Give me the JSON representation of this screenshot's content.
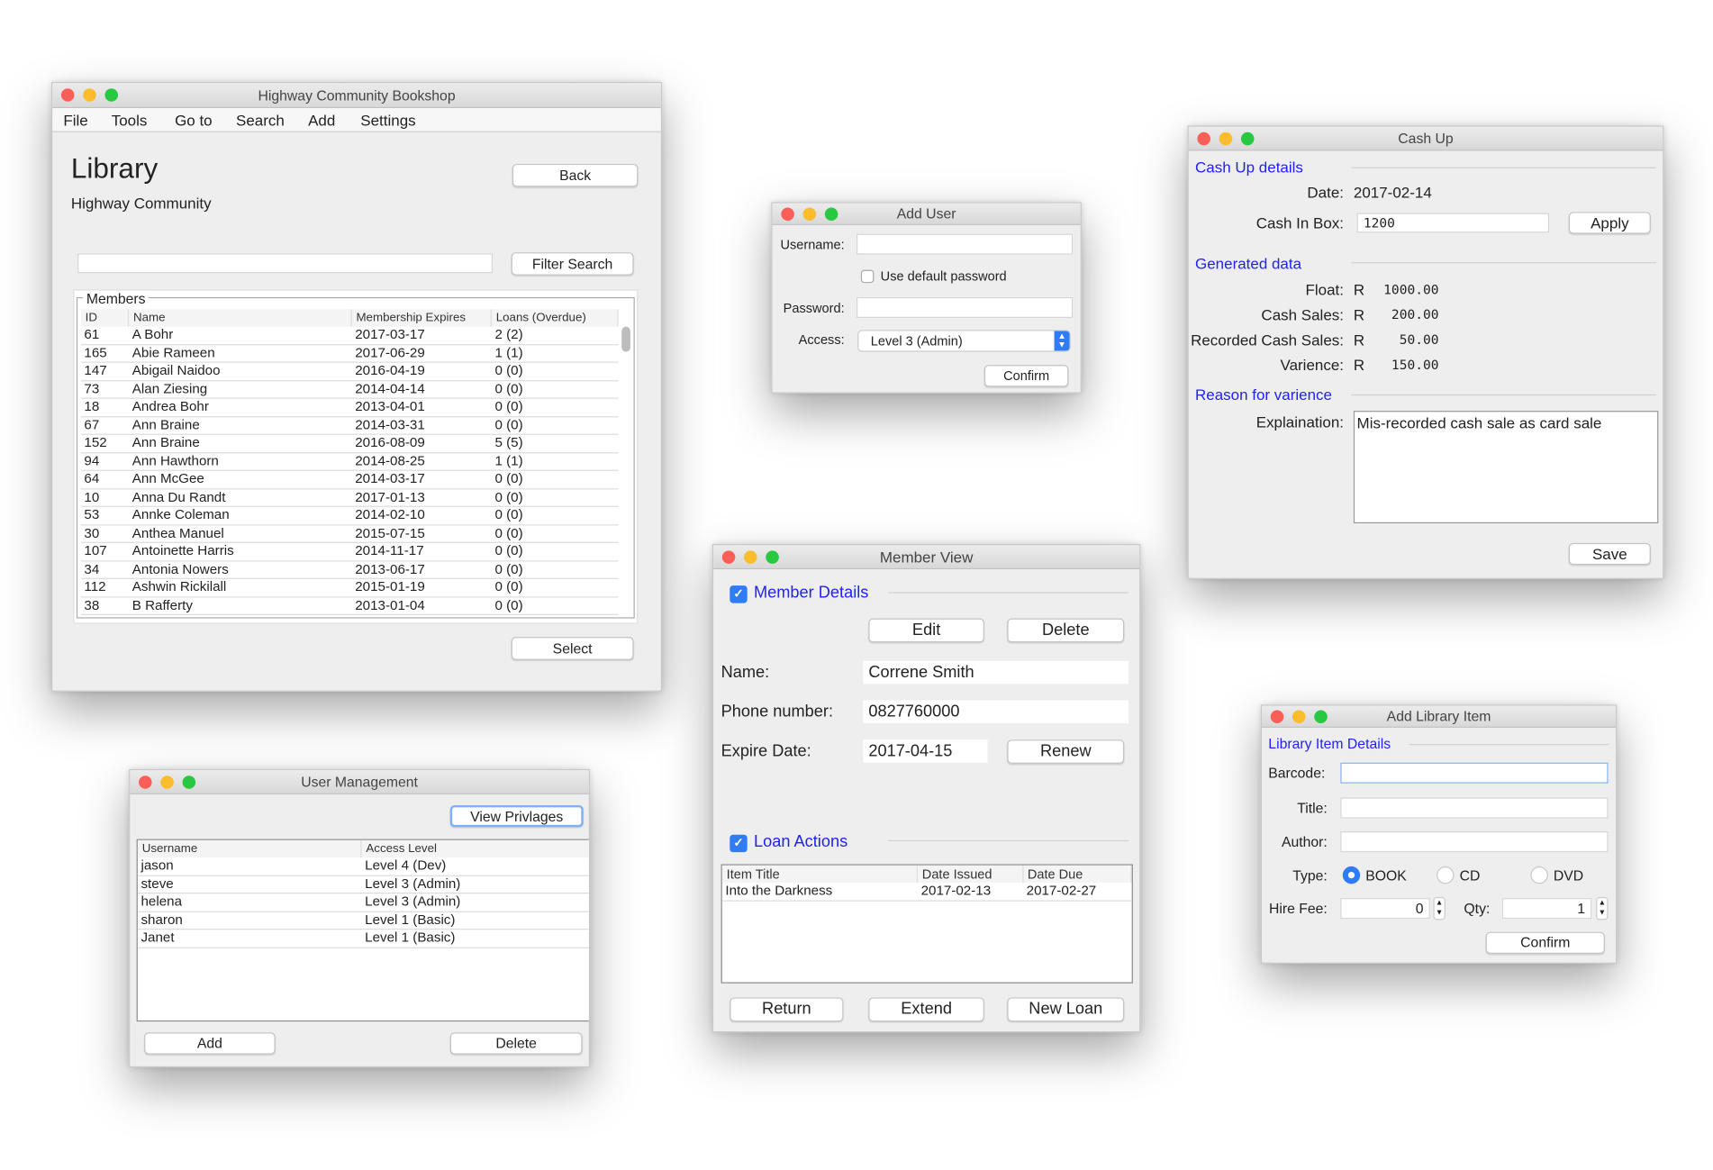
{
  "library": {
    "title": "Highway Community Bookshop",
    "menu": [
      "File",
      "Tools",
      "Go to",
      "Search",
      "Add",
      "Settings"
    ],
    "heading": "Library",
    "subheading": "Highway Community",
    "back": "Back",
    "filter_value": "",
    "filter_button": "Filter Search",
    "group_label": "Members",
    "columns": [
      "ID",
      "Name",
      "Membership Expires",
      "Loans (Overdue)"
    ],
    "rows": [
      [
        "61",
        "A Bohr",
        "2017-03-17",
        "2  (2)"
      ],
      [
        "165",
        "Abie Rameen",
        "2017-06-29",
        "1  (1)"
      ],
      [
        "147",
        "Abigail Naidoo",
        "2016-04-19",
        "0  (0)"
      ],
      [
        "73",
        "Alan Ziesing",
        "2014-04-14",
        "0  (0)"
      ],
      [
        "18",
        "Andrea Bohr",
        "2013-04-01",
        "0  (0)"
      ],
      [
        "67",
        "Ann Braine",
        "2014-03-31",
        "0  (0)"
      ],
      [
        "152",
        "Ann Braine",
        "2016-08-09",
        "5  (5)"
      ],
      [
        "94",
        "Ann Hawthorn",
        "2014-08-25",
        "1  (1)"
      ],
      [
        "64",
        "Ann McGee",
        "2014-03-17",
        "0  (0)"
      ],
      [
        "10",
        "Anna Du Randt",
        "2017-01-13",
        "0  (0)"
      ],
      [
        "53",
        "Annke Coleman",
        "2014-02-10",
        "0  (0)"
      ],
      [
        "30",
        "Anthea Manuel",
        "2015-07-15",
        "0  (0)"
      ],
      [
        "107",
        "Antoinette Harris",
        "2014-11-17",
        "0  (0)"
      ],
      [
        "34",
        "Antonia Nowers",
        "2013-06-17",
        "0  (0)"
      ],
      [
        "112",
        "Ashwin Rickilall",
        "2015-01-19",
        "0  (0)"
      ],
      [
        "38",
        "B Rafferty",
        "2013-01-04",
        "0  (0)"
      ]
    ],
    "select": "Select"
  },
  "add_user": {
    "title": "Add User",
    "username_label": "Username:",
    "username_value": "",
    "default_pw_label": "Use default password",
    "default_pw_checked": false,
    "password_label": "Password:",
    "password_value": "",
    "access_label": "Access:",
    "access_value": "Level 3 (Admin)",
    "confirm": "Confirm"
  },
  "cash_up": {
    "title": "Cash Up",
    "section1": "Cash Up details",
    "date_label": "Date:",
    "date_value": "2017-02-14",
    "cash_label": "Cash In Box:",
    "cash_value": "1200",
    "apply": "Apply",
    "section2": "Generated data",
    "currency": "R",
    "generated": [
      {
        "label": "Float:",
        "value": "1000.00"
      },
      {
        "label": "Cash Sales:",
        "value": "200.00"
      },
      {
        "label": "Recorded Cash Sales:",
        "value": "50.00"
      },
      {
        "label": "Varience:",
        "value": "150.00"
      }
    ],
    "section3": "Reason for varience",
    "explain_label": "Explaination:",
    "explain_value": "Mis-recorded cash sale as card sale",
    "save": "Save"
  },
  "member_view": {
    "title": "Member View",
    "section1": "Member Details",
    "section1_checked": true,
    "edit": "Edit",
    "delete": "Delete",
    "name_label": "Name:",
    "name_value": "Correne Smith",
    "phone_label": "Phone number:",
    "phone_value": "0827760000",
    "expire_label": "Expire Date:",
    "expire_value": "2017-04-15",
    "renew": "Renew",
    "section2": "Loan Actions",
    "section2_checked": true,
    "columns": [
      "Item Title",
      "Date Issued",
      "Date Due"
    ],
    "rows": [
      [
        "Into the Darkness",
        "2017-02-13",
        "2017-02-27"
      ]
    ],
    "return": "Return",
    "extend": "Extend",
    "new_loan": "New Loan"
  },
  "user_mgmt": {
    "title": "User Management",
    "view_privileges": "View Privlages",
    "columns": [
      "Username",
      "Access Level"
    ],
    "rows": [
      [
        "jason",
        "Level 4 (Dev)"
      ],
      [
        "steve",
        "Level 3 (Admin)"
      ],
      [
        "helena",
        "Level 3 (Admin)"
      ],
      [
        "sharon",
        "Level 1 (Basic)"
      ],
      [
        "Janet",
        "Level 1 (Basic)"
      ]
    ],
    "add": "Add",
    "delete": "Delete"
  },
  "add_item": {
    "title": "Add Library Item",
    "section": "Library Item Details",
    "barcode_label": "Barcode:",
    "title_label": "Title:",
    "author_label": "Author:",
    "type_label": "Type:",
    "types": [
      "BOOK",
      "CD",
      "DVD"
    ],
    "type_selected": "BOOK",
    "fee_label": "Hire Fee:",
    "fee_value": "0",
    "qty_label": "Qty:",
    "qty_value": "1",
    "confirm": "Confirm"
  },
  "colors": {
    "accent": "#2f7cf6",
    "section_title": "#1f1fff"
  }
}
